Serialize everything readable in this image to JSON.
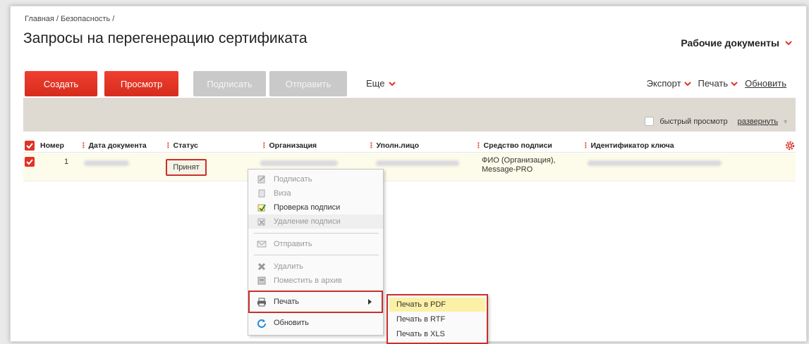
{
  "header": {
    "breadcrumb": "Главная / Безопасность /",
    "title": "Запросы на перегенерацию сертификата",
    "workdocs_label": "Рабочие документы"
  },
  "toolbar": {
    "create": "Создать",
    "view": "Просмотр",
    "sign": "Подписать",
    "send": "Отправить",
    "more": "Еще",
    "export": "Экспорт",
    "print": "Печать",
    "refresh": "Обновить"
  },
  "filter": {
    "quick_view": "быстрый просмотр",
    "expand": "развернуть"
  },
  "table": {
    "columns": [
      "Номер",
      "Дата документа",
      "Статус",
      "Организация",
      "Уполн.лицо",
      "Средство подписи",
      "Идентификатор ключа"
    ],
    "rows": [
      {
        "number": "1",
        "status": "Принят",
        "sign_tool_line1": "ФИО (Организация),",
        "sign_tool_line2": "Message-PRO"
      }
    ]
  },
  "context_menu": {
    "items": [
      {
        "label": "Подписать",
        "icon": "sign-icon",
        "enabled": false
      },
      {
        "label": "Виза",
        "icon": "visa-icon",
        "enabled": false
      },
      {
        "label": "Проверка подписи",
        "icon": "verify-signature-icon",
        "enabled": true
      },
      {
        "label": "Удаление подписи",
        "icon": "remove-signature-icon",
        "enabled": false
      },
      {
        "label": "Отправить",
        "icon": "envelope-icon",
        "enabled": false
      },
      {
        "label": "Удалить",
        "icon": "delete-icon",
        "enabled": false
      },
      {
        "label": "Поместить в архив",
        "icon": "archive-icon",
        "enabled": false
      },
      {
        "label": "Печать",
        "icon": "printer-icon",
        "enabled": true
      },
      {
        "label": "Обновить",
        "icon": "refresh-icon",
        "enabled": true
      }
    ]
  },
  "print_submenu": {
    "items": [
      "Печать в PDF",
      "Печать в RTF",
      "Печать в XLS"
    ]
  },
  "colors": {
    "accent_red": "#e03326",
    "highlight_yellow": "#fbf0a6",
    "row_bg": "#fdfbe9",
    "filter_bg": "#dedad2"
  }
}
